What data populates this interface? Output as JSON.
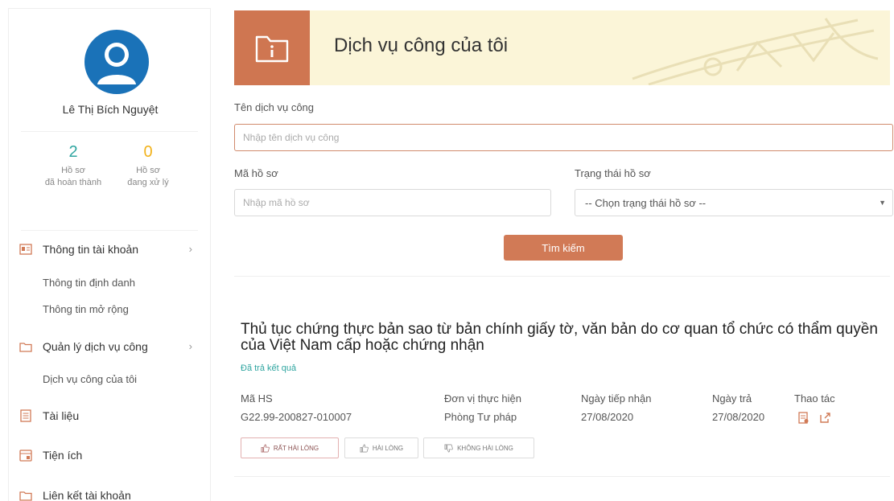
{
  "profile": {
    "name": "Lê Thị Bích Nguyệt",
    "stats": [
      {
        "value": "2",
        "label_line1": "Hồ sơ",
        "label_line2": "đã hoàn thành",
        "color": "#2fa5a0"
      },
      {
        "value": "0",
        "label_line1": "Hồ sơ",
        "label_line2": "đang xử lý",
        "color": "#f2b21b"
      }
    ]
  },
  "sidebar": {
    "account_info": {
      "label": "Thông tin tài khoản",
      "icon": "id-card-icon",
      "arrow": "›"
    },
    "account_sub": [
      "Thông tin định danh",
      "Thông tin mở rộng"
    ],
    "service_manage": {
      "label": "Quản lý dịch vụ công",
      "icon": "folder-icon",
      "arrow": "›"
    },
    "service_sub": [
      "Dịch vụ công của tôi"
    ],
    "documents": {
      "label": "Tài liệu",
      "icon": "document-icon"
    },
    "utilities": {
      "label": "Tiện ích",
      "icon": "utility-icon"
    },
    "linked_accounts": {
      "label": "Liên kết tài khoản",
      "icon": "folder-icon"
    }
  },
  "banner": {
    "title": "Dịch vụ công của tôi",
    "icon": "folder-info-icon"
  },
  "search": {
    "service_name_label": "Tên dịch vụ công",
    "service_name_placeholder": "Nhập tên dịch vụ công",
    "file_code_label": "Mã hồ sơ",
    "file_code_placeholder": "Nhập mã hồ sơ",
    "status_label": "Trạng thái hồ sơ",
    "status_selected": "-- Chọn trạng thái hồ sơ --",
    "search_button": "Tìm kiếm"
  },
  "record": {
    "title": "Thủ tục chứng thực bản sao từ bản chính giấy tờ, văn bản do cơ quan tổ chức có thẩm quyền của Việt Nam cấp hoặc chứng nhận",
    "status": "Đã trả kết quả",
    "columns": [
      {
        "header": "Mã HS",
        "value": "G22.99-200827-010007"
      },
      {
        "header": "Đơn vị thực hiện",
        "value": "Phòng Tư pháp"
      },
      {
        "header": "Ngày tiếp nhận",
        "value": "27/08/2020"
      },
      {
        "header": "Ngày trả",
        "value": "27/08/2020"
      },
      {
        "header": "Thao tác",
        "value": ""
      }
    ],
    "ratings": [
      "RẤT HÀI LÒNG",
      "HÀI LÒNG",
      "KHÔNG HÀI LÒNG"
    ]
  },
  "colors": {
    "accent": "#d17a56",
    "banner_bg": "#fbf5d8",
    "avatar": "#1a72b8",
    "status_green": "#2fa5a0"
  }
}
